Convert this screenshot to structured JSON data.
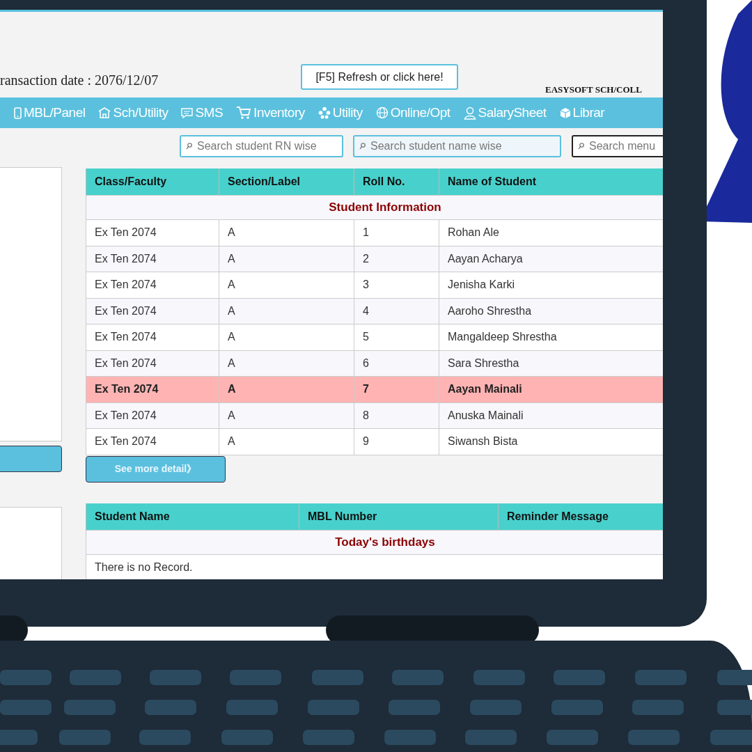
{
  "header": {
    "transaction_date": "ransaction date : 2076/12/07",
    "refresh_button": "[F5] Refresh or click here!",
    "brand": "EASYSOFT SCH/COLL"
  },
  "menu": [
    "MBL/Panel",
    "Sch/Utility",
    "SMS",
    "Inventory",
    "Utility",
    "Online/Opt",
    "SalarySheet",
    "Librar"
  ],
  "search_fields": [
    {
      "placeholder": "Search student RN wise"
    },
    {
      "placeholder": "Search student name wise"
    },
    {
      "placeholder": "Search menu"
    }
  ],
  "students_table": {
    "columns": [
      "Class/Faculty",
      "Section/Label",
      "Roll No.",
      "Name of Student"
    ],
    "section_title": "Student Information",
    "rows": [
      {
        "cells": [
          "Ex Ten 2074",
          "A",
          "1",
          "Rohan Ale"
        ],
        "selected": false
      },
      {
        "cells": [
          "Ex Ten 2074",
          "A",
          "2",
          "Aayan Acharya"
        ],
        "selected": false
      },
      {
        "cells": [
          "Ex Ten 2074",
          "A",
          "3",
          "Jenisha Karki"
        ],
        "selected": false
      },
      {
        "cells": [
          "Ex Ten 2074",
          "A",
          "4",
          "Aaroho Shrestha"
        ],
        "selected": false
      },
      {
        "cells": [
          "Ex Ten 2074",
          "A",
          "5",
          "Mangaldeep Shrestha"
        ],
        "selected": false
      },
      {
        "cells": [
          "Ex Ten 2074",
          "A",
          "6",
          "Sara Shrestha"
        ],
        "selected": false
      },
      {
        "cells": [
          "Ex Ten 2074",
          "A",
          "7",
          "Aayan Mainali"
        ],
        "selected": true
      },
      {
        "cells": [
          "Ex Ten 2074",
          "A",
          "8",
          "Anuska Mainali"
        ],
        "selected": false
      },
      {
        "cells": [
          "Ex Ten 2074",
          "A",
          "9",
          "Siwansh Bista"
        ],
        "selected": false
      }
    ]
  },
  "see_more_button": "See more detail》",
  "birthdays_table": {
    "columns": [
      "Student Name",
      "MBL Number",
      "Reminder Message"
    ],
    "section_title": "Today's birthdays",
    "empty_message": "There is no Record."
  }
}
